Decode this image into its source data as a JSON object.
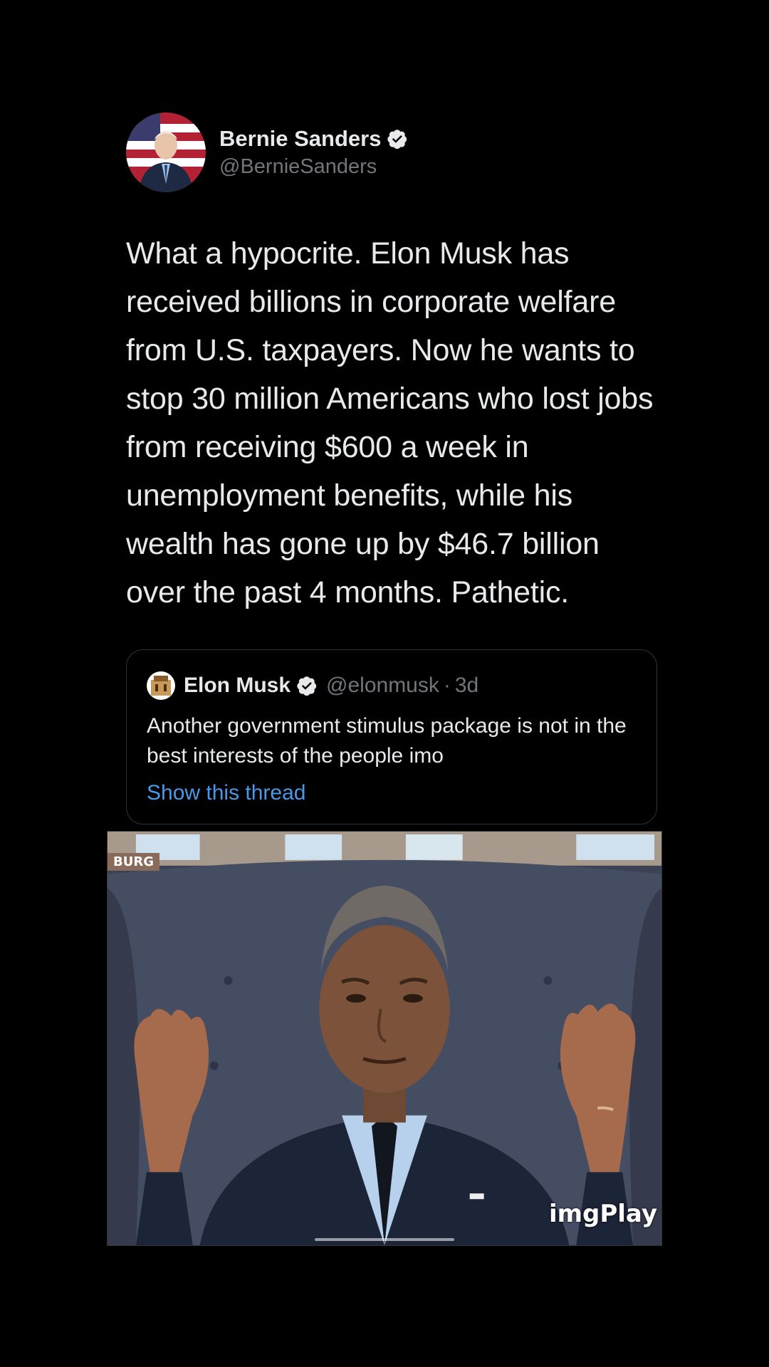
{
  "tweet": {
    "author_name": "Bernie Sanders",
    "author_handle": "@BernieSanders",
    "text": "What a hypocrite. Elon Musk has received billions in corporate welfare from U.S. taxpayers. Now he wants to stop 30 million Americans who lost jobs from receiving $600 a week in unemployment benefits, while his wealth has gone up by $46.7 billion over the past 4 months. Pathetic."
  },
  "quote": {
    "author_name": "Elon Musk",
    "author_handle": "@elonmusk",
    "separator": "·",
    "time": "3d",
    "text": "Another government stimulus package is not in the best interests of the people imo",
    "link_label": "Show this thread"
  },
  "media": {
    "watermark": "imgPlay",
    "corner_logo": "BURG",
    "progress_fraction": 0.0
  },
  "colors": {
    "background": "#000000",
    "text": "#e7e9ea",
    "secondary": "#71767b",
    "link": "#4a99e9",
    "border": "#2f3336"
  },
  "icons": {
    "verified": "verified-badge-icon"
  }
}
